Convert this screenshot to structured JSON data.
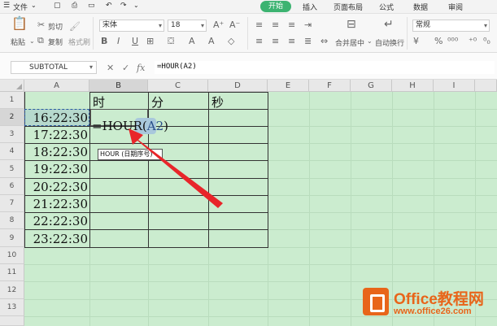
{
  "menu": {
    "file_label": "文件",
    "tabs": [
      "开始",
      "插入",
      "页面布局",
      "公式",
      "数据",
      "审阅"
    ],
    "active_tab": "开始"
  },
  "ribbon": {
    "paste_label": "粘贴",
    "cut_label": "剪切",
    "copy_label": "复制",
    "format_painter_label": "格式刷",
    "font_name": "宋体",
    "font_size": "18",
    "merge_center_label": "合并居中",
    "wrap_text_label": "自动换行",
    "number_format": "常规",
    "bold": "B",
    "italic": "I",
    "underline": "U"
  },
  "formula_bar": {
    "name_box": "SUBTOTAL",
    "fx_label": "fx",
    "formula": "=HOUR(A2)"
  },
  "grid": {
    "columns": [
      "A",
      "B",
      "C",
      "D",
      "E",
      "F",
      "G",
      "H",
      "I"
    ],
    "rows": [
      "1",
      "2",
      "3",
      "4",
      "5",
      "6",
      "7",
      "8",
      "9",
      "10",
      "11",
      "12",
      "13"
    ],
    "headers": {
      "b1": "时",
      "c1": "分",
      "d1": "秒"
    },
    "times": [
      "16:22:30",
      "17:22:30",
      "18:22:30",
      "19:22:30",
      "20:22:30",
      "21:22:30",
      "22:22:30",
      "23:22:30"
    ],
    "edit_text_prefix": "=HOUR(",
    "edit_ref": "A2",
    "edit_text_suffix": ")",
    "tooltip": "HOUR (日期序号)"
  },
  "watermark": {
    "name": "Office教程网",
    "url": "www.office26.com"
  },
  "colors": {
    "grid_bg": "#cbeccf",
    "accent": "#3cb371",
    "arrow": "#e8252a",
    "watermark": "#e8651a"
  }
}
